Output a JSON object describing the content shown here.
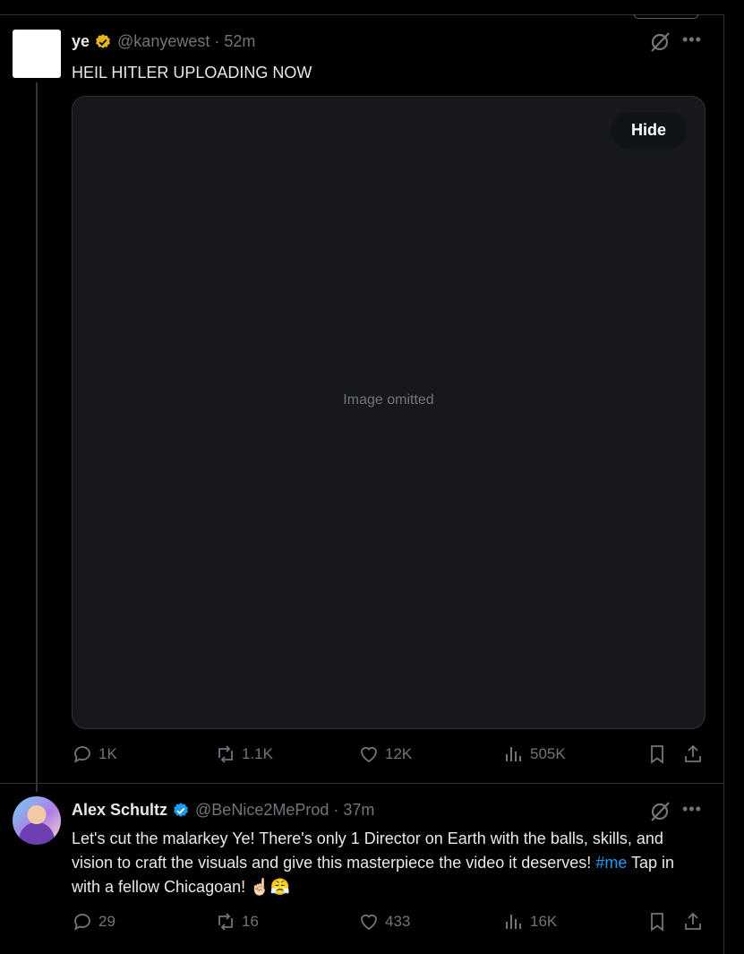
{
  "posts": [
    {
      "display_name": "ye",
      "verified": "gold",
      "handle": "@kanyewest",
      "time": "52m",
      "text": "HEIL HITLER UPLOADING NOW",
      "media": {
        "hide_label": "Hide",
        "placeholder": "Image omitted"
      },
      "stats": {
        "replies": "1K",
        "reposts": "1.1K",
        "likes": "12K",
        "views": "505K"
      }
    },
    {
      "display_name": "Alex Schultz",
      "verified": "blue",
      "handle": "@BeNice2MeProd",
      "time": "37m",
      "text": "Let's cut the malarkey Ye!  There's only 1 Director on Earth with the balls, skills, and vision to craft the visuals and give this masterpiece the video it deserves!",
      "hashtag": "#me",
      "text_tail": " Tap in with a fellow Chicagoan! ☝🏻😤",
      "stats": {
        "replies": "29",
        "reposts": "16",
        "likes": "433",
        "views": "16K"
      }
    }
  ],
  "icons": [
    "grok-icon",
    "more-icon",
    "reply-icon",
    "repost-icon",
    "like-icon",
    "views-icon",
    "bookmark-icon",
    "share-icon",
    "verified-badge-icon"
  ],
  "colors": {
    "background": "#000000",
    "text": "#e7e9ea",
    "muted": "#71767b",
    "gold_badge": "#e2b719",
    "blue_badge": "#1d9bf0",
    "link": "#1d9bf0"
  }
}
